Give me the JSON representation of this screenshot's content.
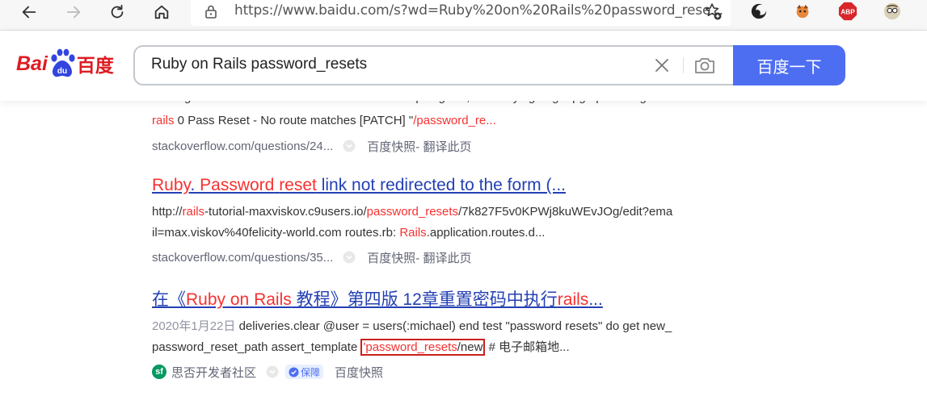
{
  "browser": {
    "url": "https://www.baidu.com/s?wd=Ruby%20on%20Rails%20password_rese...",
    "extensions": [
      "moon-extension-icon",
      "cat-extension-icon",
      "adblock-plus-icon",
      "profile-avatar-icon"
    ],
    "abp_label": "ABP"
  },
  "header": {
    "logo_bai": "Bai",
    "logo_du": "du",
    "logo_cn": "百度",
    "query": "Ruby on Rails password_resets",
    "search_button": "百度一下"
  },
  "results": {
    "r0": {
      "cut_line": "Getting error: Peer authentication failed for user \"postgres\", when trying to get pgsql working with",
      "s_em1": "rails",
      "s_mid": " 0 Pass Reset - No route matches [PATCH] \"",
      "s_em2": "/password_re...",
      "domain": "stackoverflow.com/questions/24...",
      "snapshot": "百度快照",
      "translate": " - 翻译此页"
    },
    "r1": {
      "t_em1": "Ruby",
      "t_p1": ". ",
      "t_em2": "Password",
      "t_p2": " ",
      "t_em3": "reset",
      "t_p3": " link not redirected to the form (...",
      "l1_a": "http://",
      "l1_em1": "rails",
      "l1_b": "-tutorial-maxviskov.c9users.io/",
      "l1_em2": "password_resets",
      "l1_c": "/7k827F5v0KPWj8kuWEvJOg/edit?ema",
      "l2_a": "il=max.viskov%40felicity-world.com routes.rb: ",
      "l2_em": "Rails",
      "l2_b": ".application.routes.d...",
      "domain": "stackoverflow.com/questions/35...",
      "snapshot": "百度快照",
      "translate": " - 翻译此页"
    },
    "r2": {
      "t_p1": "在《",
      "t_em1": "Ruby",
      "t_p2": " ",
      "t_em2": "on",
      "t_p3": " ",
      "t_em3": "Rails",
      "t_p4": " 教程》第四版 12章重置密码中执行",
      "t_em4": "rails",
      "t_p5": "...",
      "date": "2020年1月22日",
      "l1": " deliveries.clear @user = users(:michael) end test \"password resets\" do get new_",
      "l2_a": "password_reset_path assert_template ",
      "l2_q": "'",
      "l2_em": "password_resets",
      "l2_new": "/new",
      "l2_b": " # 电子邮箱地...",
      "source": "思否开发者社区",
      "source_logo": "sf",
      "badge": "保障",
      "snapshot": "百度快照"
    }
  },
  "colors": {
    "accent": "#4e6ef2",
    "em": "#f73131",
    "link": "#2440b3",
    "brand": "#de1b22",
    "box": "#c8201e"
  }
}
